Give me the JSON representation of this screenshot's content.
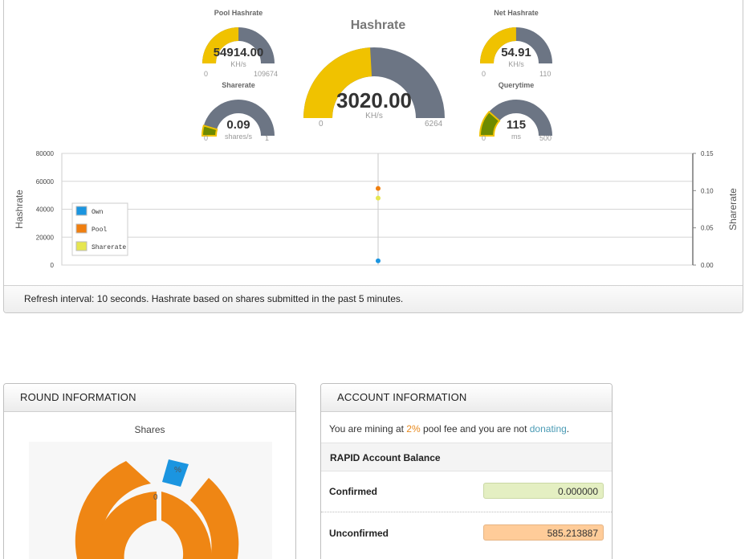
{
  "gauges": {
    "pool_hashrate": {
      "title": "Pool Hashrate",
      "value": "54914.00",
      "unit": "KH/s",
      "min": "0",
      "max": "109674",
      "level": 0.5007
    },
    "sharerate": {
      "title": "Sharerate",
      "value": "0.09",
      "unit": "shares/s",
      "min": "0",
      "max": "1",
      "level": 0.09
    },
    "hashrate": {
      "title": "Hashrate",
      "value": "3020.00",
      "unit": "KH/s",
      "min": "0",
      "max": "6264",
      "level": 0.4821
    },
    "net_hashrate": {
      "title": "Net Hashrate",
      "value": "54.91",
      "unit": "KH/s",
      "min": "0",
      "max": "110",
      "level": 0.4992
    },
    "querytime": {
      "title": "Querytime",
      "value": "115",
      "unit": "ms",
      "min": "0",
      "max": "500",
      "level": 0.23
    }
  },
  "colors": {
    "gauge_fill": "#f0c200",
    "gauge_fill_dark": "#6e8a00",
    "gauge_track": "#6c7584",
    "own": "#1b95e0",
    "pool": "#f07f10",
    "sharerate": "#e6e650"
  },
  "chart_data": {
    "type": "scatter",
    "ylabel": "Hashrate",
    "y2label": "Sharerate",
    "ylim": [
      0,
      80000
    ],
    "y2lim": [
      0,
      0.15
    ],
    "yticks": [
      "0",
      "20000",
      "40000",
      "60000",
      "80000"
    ],
    "y2ticks": [
      "0.00",
      "0.05",
      "0.10",
      "0.15"
    ],
    "grid": true,
    "legend_position": "left",
    "series": [
      {
        "name": "Own",
        "axis": "left",
        "values": [
          3020
        ],
        "color": "#1b95e0"
      },
      {
        "name": "Pool",
        "axis": "left",
        "values": [
          54914
        ],
        "color": "#f07f10"
      },
      {
        "name": "Sharerate",
        "axis": "right",
        "values": [
          0.09
        ],
        "color": "#e6e650"
      }
    ]
  },
  "footer": {
    "refresh_text": "Refresh interval: 10 seconds. Hashrate based on shares submitted in the past 5 minutes."
  },
  "round": {
    "header": "ROUND INFORMATION",
    "shares_title": "Shares",
    "pie_label_1": "%",
    "pie_label_2": "0"
  },
  "account": {
    "header": "ACCOUNT INFORMATION",
    "mining_prefix": "You are mining at ",
    "fee": "2%",
    "mining_middle": " pool fee and you are not ",
    "donating": "donating",
    "mining_suffix": ".",
    "balance_title": "RAPID Account Balance",
    "confirmed_label": "Confirmed",
    "confirmed_value": "0.000000",
    "unconfirmed_label": "Unconfirmed",
    "unconfirmed_value": "585.213887"
  }
}
